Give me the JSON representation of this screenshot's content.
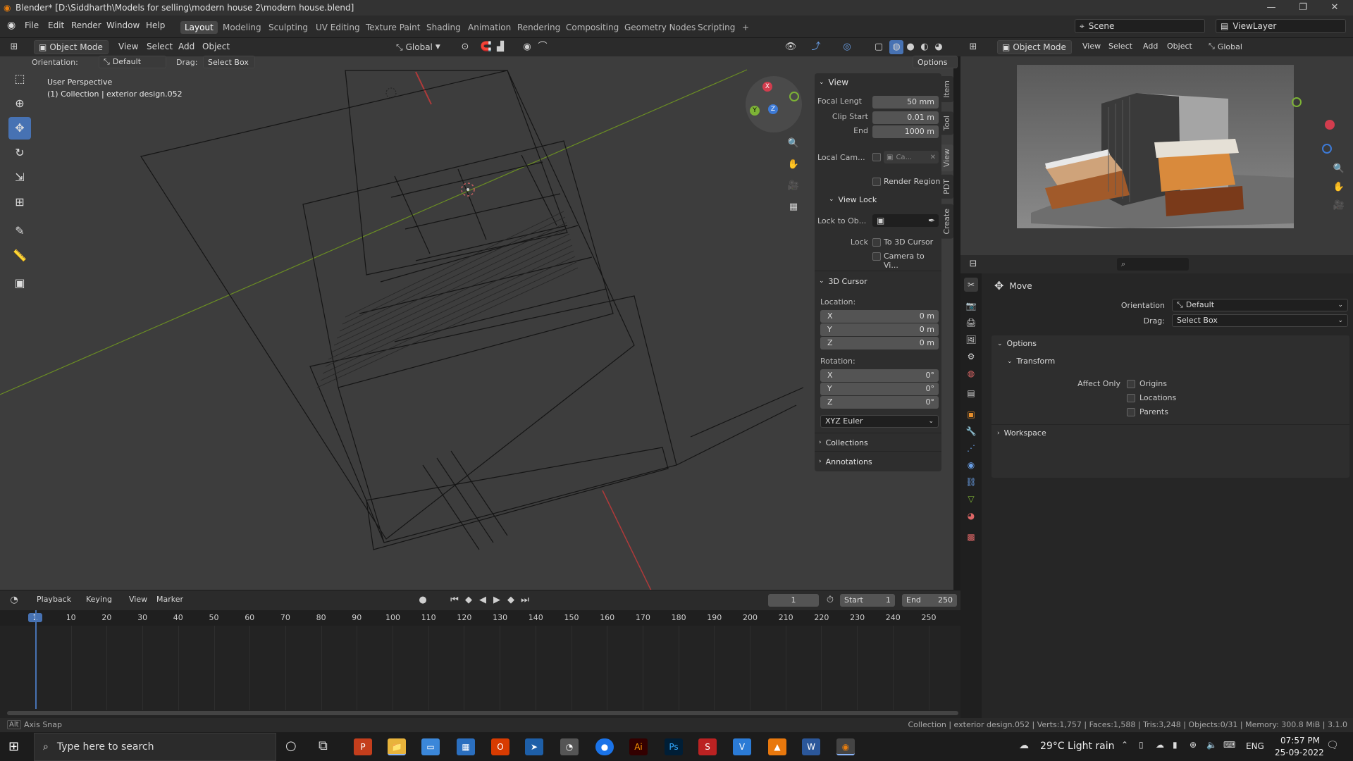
{
  "titlebar": {
    "title": "Blender* [D:\\Siddharth\\Models for selling\\modern house 2\\modern house.blend]"
  },
  "menu": [
    "File",
    "Edit",
    "Render",
    "Window",
    "Help"
  ],
  "workspaces": [
    "Layout",
    "Modeling",
    "Sculpting",
    "UV Editing",
    "Texture Paint",
    "Shading",
    "Animation",
    "Rendering",
    "Compositing",
    "Geometry Nodes",
    "Scripting",
    "+"
  ],
  "scene": {
    "name": "Scene",
    "view_layer": "ViewLayer"
  },
  "vp_header": {
    "mode": "Object Mode",
    "view": "View",
    "select": "Select",
    "add": "Add",
    "object": "Object",
    "orientation_global": "Global",
    "options": "Options"
  },
  "vp_toolbar": {
    "orientation_label": "Orientation:",
    "orientation_value": "Default",
    "drag_label": "Drag:",
    "drag_value": "Select Box"
  },
  "viewport": {
    "perspective": "User Perspective",
    "collection": "(1) Collection | exterior design.052"
  },
  "gizmo": {
    "x": "X",
    "y": "Y",
    "z": "Z"
  },
  "npanel": {
    "tabs": [
      "Item",
      "Tool",
      "View",
      "PDT",
      "Create"
    ],
    "view_header": "View",
    "focal_label": "Focal Lengt",
    "focal_value": "50 mm",
    "clip_start_label": "Clip Start",
    "clip_start_value": "0.01 m",
    "end_label": "End",
    "end_value": "1000 m",
    "local_cam_label": "Local Cam...",
    "local_cam_value": "Ca...",
    "render_region": "Render Region",
    "view_lock_header": "View Lock",
    "lock_to_obj_label": "Lock to Ob...",
    "lock_label": "Lock",
    "to_3d_cursor": "To 3D Cursor",
    "camera_to_view": "Camera to Vi...",
    "cursor_header": "3D Cursor",
    "location_label": "Location:",
    "loc": [
      {
        "axis": "X",
        "value": "0 m"
      },
      {
        "axis": "Y",
        "value": "0 m"
      },
      {
        "axis": "Z",
        "value": "0 m"
      }
    ],
    "rotation_label": "Rotation:",
    "rot": [
      {
        "axis": "X",
        "value": "0°"
      },
      {
        "axis": "Y",
        "value": "0°"
      },
      {
        "axis": "Z",
        "value": "0°"
      }
    ],
    "rotation_mode": "XYZ Euler",
    "collections": "Collections",
    "annotations": "Annotations"
  },
  "timeline": {
    "playback": "Playback",
    "keying": "Keying",
    "view": "View",
    "marker": "Marker",
    "current_frame": "1",
    "start_label": "Start",
    "start_value": "1",
    "end_label": "End",
    "end_value": "250",
    "ticks": [
      "1",
      "10",
      "20",
      "30",
      "40",
      "50",
      "60",
      "70",
      "80",
      "90",
      "100",
      "110",
      "120",
      "130",
      "140",
      "150",
      "160",
      "170",
      "180",
      "190",
      "200",
      "210",
      "220",
      "230",
      "240",
      "250"
    ]
  },
  "preview_header": {
    "mode": "Object Mode",
    "view": "View",
    "select": "Select",
    "add": "Add",
    "object": "Object",
    "orientation": "Global"
  },
  "properties": {
    "tool_name": "Move",
    "orientation_label": "Orientation",
    "orientation_value": "Default",
    "drag_label": "Drag:",
    "drag_value": "Select Box",
    "options": "Options",
    "transform": "Transform",
    "affect_only": "Affect Only",
    "origins": "Origins",
    "locations": "Locations",
    "parents": "Parents",
    "workspace": "Workspace"
  },
  "statusbar": {
    "left": "Axis Snap",
    "right": "Collection | exterior design.052 | Verts:1,757 | Faces:1,588 | Tris:3,248 | Objects:0/31 | Memory: 300.8 MiB | 3.1.0"
  },
  "taskbar": {
    "search": "Type here to search",
    "weather": "29°C  Light rain",
    "lang": "ENG",
    "time": "07:57 PM",
    "date": "25-09-2022",
    "apps": [
      "P",
      "📁",
      "▭",
      "▦",
      "O",
      "➤",
      "◔",
      "●",
      "Ai",
      "Ps",
      "S",
      "V",
      "▲",
      "W",
      "◉"
    ]
  }
}
